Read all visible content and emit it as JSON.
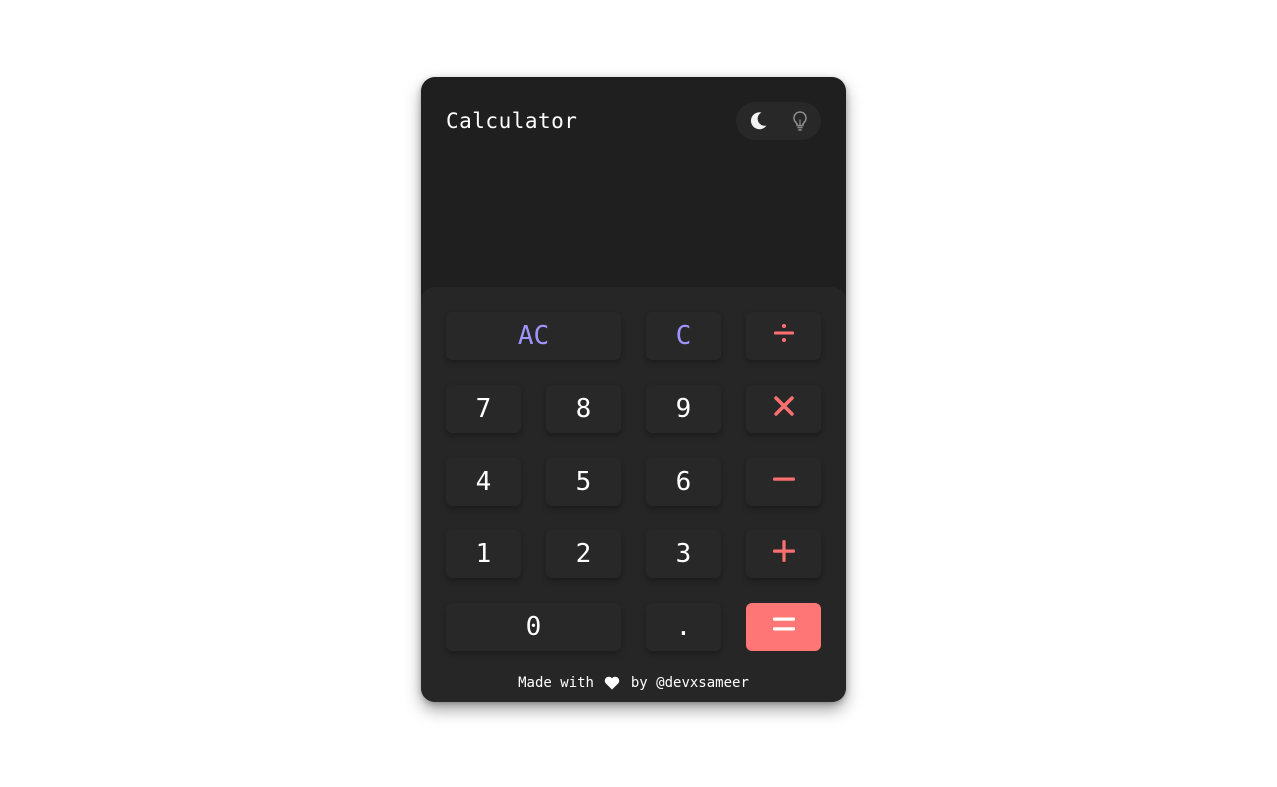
{
  "app": {
    "title": "Calculator",
    "display_value": ""
  },
  "theme_toggle": {
    "dark_icon": "moon-icon",
    "light_icon": "lightbulb-icon"
  },
  "keys": {
    "all_clear": "AC",
    "clear": "C",
    "divide": "÷",
    "multiply": "✕",
    "subtract": "−",
    "add": "+",
    "equals": "=",
    "seven": "7",
    "eight": "8",
    "nine": "9",
    "four": "4",
    "five": "5",
    "six": "6",
    "one": "1",
    "two": "2",
    "three": "3",
    "zero": "0",
    "decimal": "."
  },
  "footer": {
    "prefix": "Made with",
    "icon": "heart-icon",
    "suffix": "by",
    "author": "@devxsameer"
  },
  "colors": {
    "background": "#1f1f1f",
    "keypad": "#262626",
    "key": "#282828",
    "clear_text": "#9e94ff",
    "operator_text": "#ff6f6f",
    "equals_bg": "#ff7676"
  }
}
